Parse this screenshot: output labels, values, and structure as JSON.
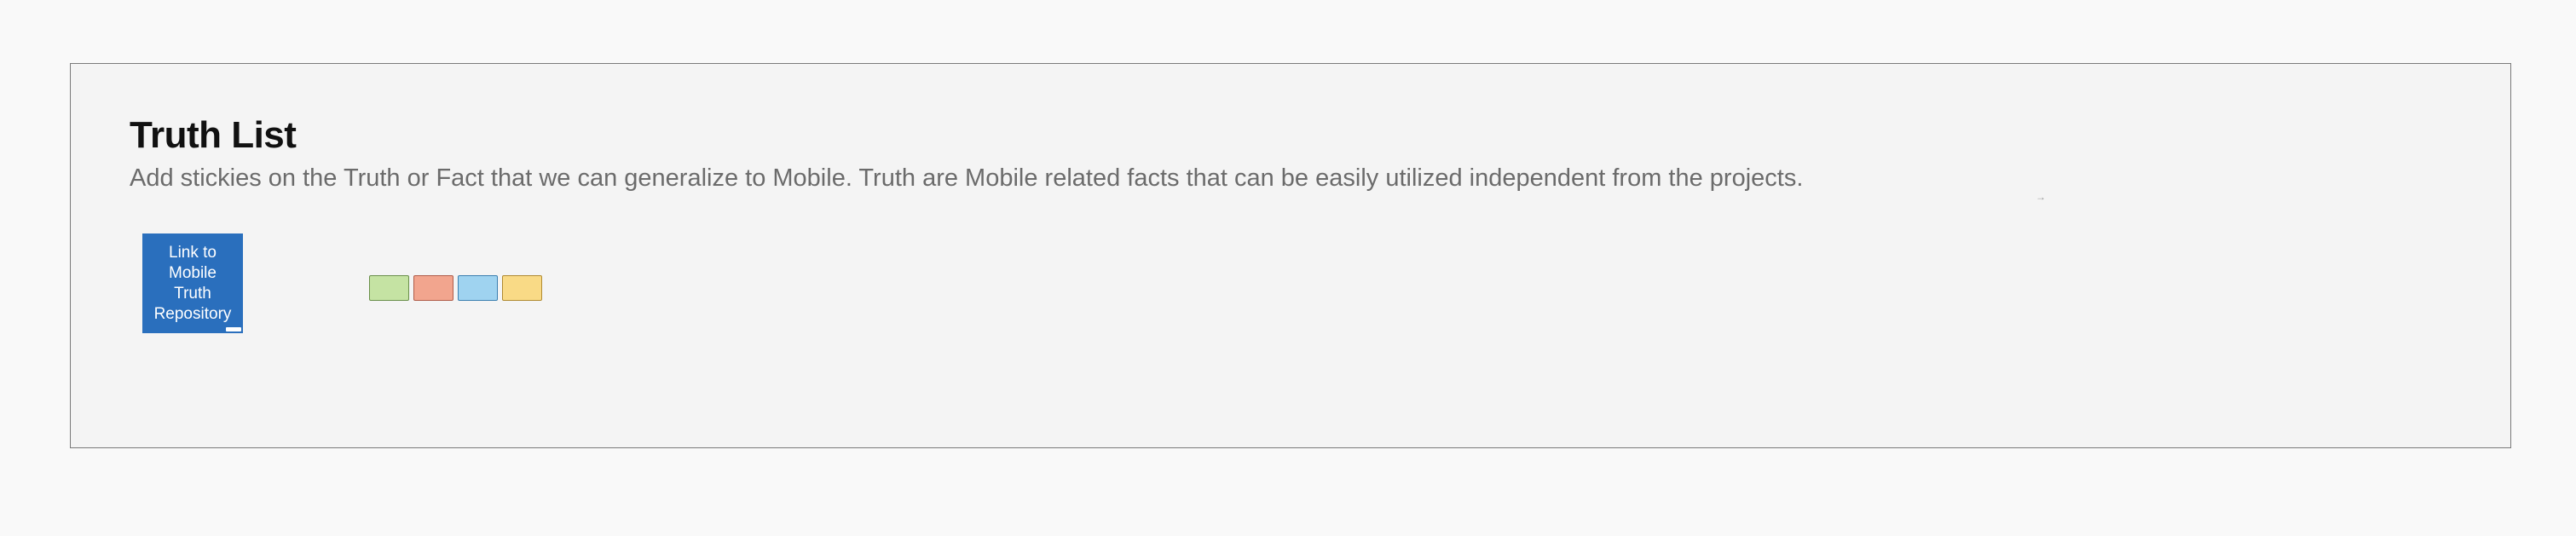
{
  "board": {
    "title": "Truth List",
    "subtitle": "Add stickies on the Truth or Fact that we can generalize to Mobile. Truth are Mobile related facts that can be easily utilized independent from the projects.",
    "link_card_label": "Link to Mobile Truth Repository",
    "arrow_hint": "→",
    "colors": {
      "background": "#f9f9f9",
      "frame_fill": "#f4f4f4",
      "frame_border": "#7a7a7a",
      "link_card": "#2a6fbd"
    }
  },
  "stickies": [
    {
      "text": "",
      "color": "#c5e3a3",
      "border": "#6a8f4a"
    },
    {
      "text": "",
      "color": "#f2a58e",
      "border": "#b05c48"
    },
    {
      "text": "",
      "color": "#9fd3f0",
      "border": "#3a7fb0"
    },
    {
      "text": "",
      "color": "#f9da86",
      "border": "#b08a30"
    }
  ]
}
